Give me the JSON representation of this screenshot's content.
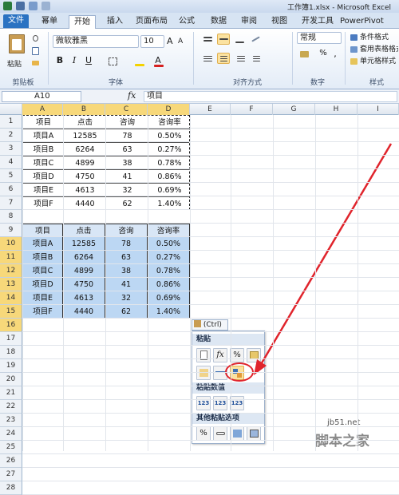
{
  "window": {
    "title": "工作簿1.xlsx - Microsoft Excel"
  },
  "tabs": [
    {
      "label": "文件",
      "kind": "file"
    },
    {
      "label": "幂单",
      "kind": ""
    },
    {
      "label": "开始",
      "kind": "active"
    },
    {
      "label": "插入",
      "kind": ""
    },
    {
      "label": "页面布局",
      "kind": ""
    },
    {
      "label": "公式",
      "kind": ""
    },
    {
      "label": "数据",
      "kind": ""
    },
    {
      "label": "审阅",
      "kind": ""
    },
    {
      "label": "视图",
      "kind": ""
    },
    {
      "label": "开发工具",
      "kind": ""
    },
    {
      "label": "PowerPivot",
      "kind": ""
    }
  ],
  "ribbon": {
    "paste_label": "粘贴",
    "clipboard_group": "剪贴板",
    "font_name": "微软雅黑",
    "font_size": "10",
    "bold": "B",
    "italic": "I",
    "underline": "U",
    "font_group": "字体",
    "align_group": "对齐方式",
    "number_format": "常规",
    "percent": "%",
    "comma": ",",
    "number_group": "数字",
    "styles": {
      "cond_format": "条件格式",
      "table_format": "套用表格格式",
      "cell_style": "单元格样式",
      "group": "样式"
    }
  },
  "formula_bar": {
    "name_box": "A10",
    "fx": "fx",
    "content": "项目"
  },
  "columns": [
    "A",
    "B",
    "C",
    "D",
    "E",
    "F",
    "G",
    "H",
    "I"
  ],
  "rows": [
    "1",
    "2",
    "3",
    "4",
    "5",
    "6",
    "7",
    "8",
    "9",
    "10",
    "11",
    "12",
    "13",
    "14",
    "15",
    "16",
    "17",
    "18",
    "19",
    "20",
    "21",
    "22",
    "23",
    "24",
    "25",
    "26",
    "27",
    "28"
  ],
  "table1": {
    "header": [
      "项目",
      "点击",
      "咨询",
      "咨询率"
    ],
    "rows": [
      [
        "项目A",
        "12585",
        "78",
        "0.50%"
      ],
      [
        "项目B",
        "6264",
        "63",
        "0.27%"
      ],
      [
        "项目C",
        "4899",
        "38",
        "0.78%"
      ],
      [
        "项目D",
        "4750",
        "41",
        "0.86%"
      ],
      [
        "项目E",
        "4613",
        "32",
        "0.69%"
      ],
      [
        "项目F",
        "4440",
        "62",
        "1.40%"
      ]
    ]
  },
  "table2": {
    "header": [
      "项目",
      "点击",
      "咨询",
      "咨询率"
    ],
    "rows": [
      [
        "项目A",
        "12585",
        "78",
        "0.50%"
      ],
      [
        "项目B",
        "6264",
        "63",
        "0.27%"
      ],
      [
        "项目C",
        "4899",
        "38",
        "0.78%"
      ],
      [
        "项目D",
        "4750",
        "41",
        "0.86%"
      ],
      [
        "项目E",
        "4613",
        "32",
        "0.69%"
      ],
      [
        "项目F",
        "4440",
        "62",
        "1.40%"
      ]
    ]
  },
  "paste_menu": {
    "trigger": "(Ctrl) ▾",
    "section_paste": "粘贴",
    "section_values": "粘贴数值",
    "section_other": "其他粘贴选项",
    "value_icon_text": "123",
    "fx_icon_text": "fx",
    "pct_icon_text": "%"
  },
  "watermark": {
    "site": "jb51.net",
    "brand": "脚本之家"
  },
  "colors": {
    "accent": "#2a72c2",
    "selection": "#bcd7f3",
    "header_sel": "#f7d87a",
    "annotation": "#e0242c"
  }
}
